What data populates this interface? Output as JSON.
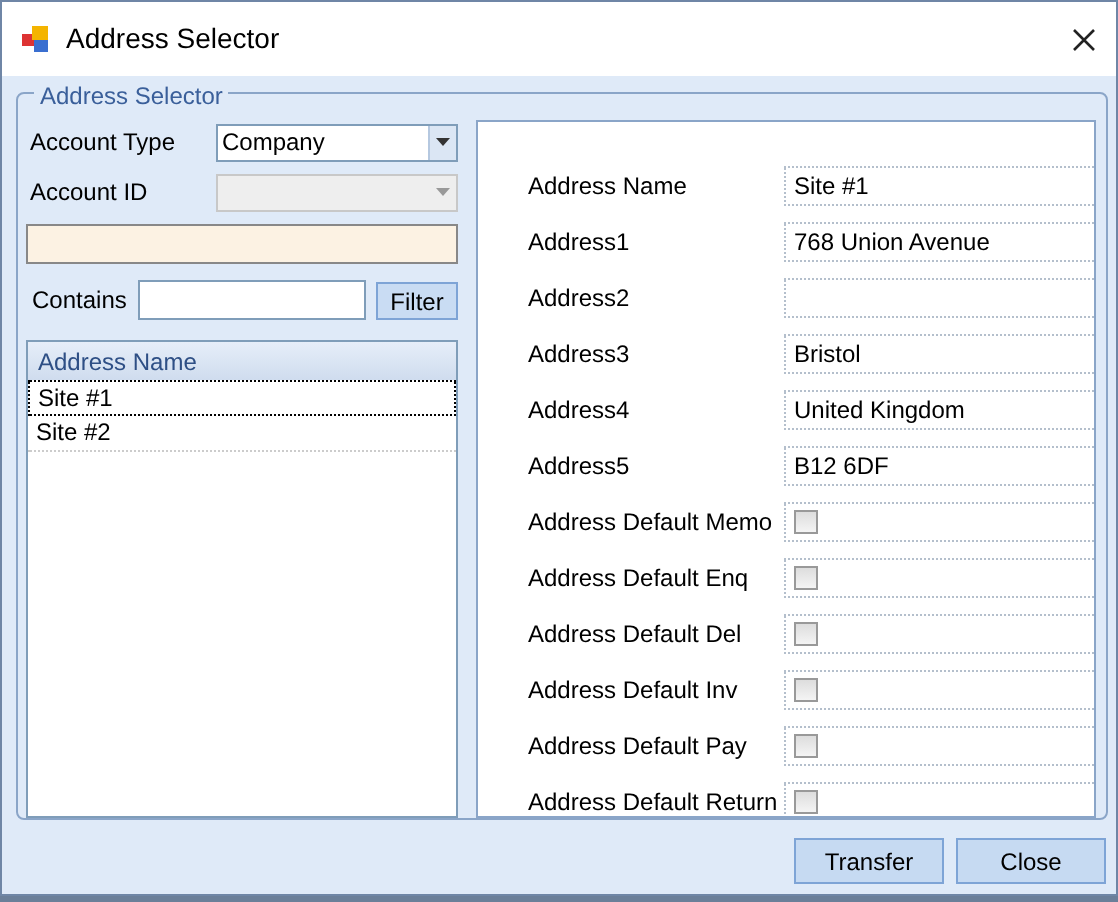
{
  "window": {
    "title": "Address Selector"
  },
  "group": {
    "legend": "Address Selector"
  },
  "account_type": {
    "label": "Account Type",
    "value": "Company"
  },
  "account_id": {
    "label": "Account ID",
    "disabled": true
  },
  "contains": {
    "label": "Contains"
  },
  "filter_button": "Filter",
  "list": {
    "column": "Address Name",
    "rows": [
      {
        "text": "Site #1",
        "selected": true
      },
      {
        "text": "Site #2",
        "selected": false
      }
    ]
  },
  "fields": [
    {
      "kind": "text",
      "label": "Address Name",
      "value": "Site #1"
    },
    {
      "kind": "text",
      "label": "Address1",
      "value": "768 Union Avenue"
    },
    {
      "kind": "text",
      "label": "Address2"
    },
    {
      "kind": "text",
      "label": "Address3",
      "value": "Bristol"
    },
    {
      "kind": "text",
      "label": "Address4",
      "value": "United Kingdom"
    },
    {
      "kind": "text",
      "label": "Address5",
      "value": "B12 6DF"
    },
    {
      "kind": "checkbox",
      "label": "Address Default Memo",
      "checked": false
    },
    {
      "kind": "checkbox",
      "label": "Address Default Enq",
      "checked": false
    },
    {
      "kind": "checkbox",
      "label": "Address Default Del",
      "checked": false
    },
    {
      "kind": "checkbox",
      "label": "Address Default Inv",
      "checked": false
    },
    {
      "kind": "checkbox",
      "label": "Address Default Pay",
      "checked": false
    },
    {
      "kind": "checkbox",
      "label": "Address Default Return",
      "checked": false
    }
  ],
  "buttons": [
    "Transfer",
    "Close"
  ]
}
